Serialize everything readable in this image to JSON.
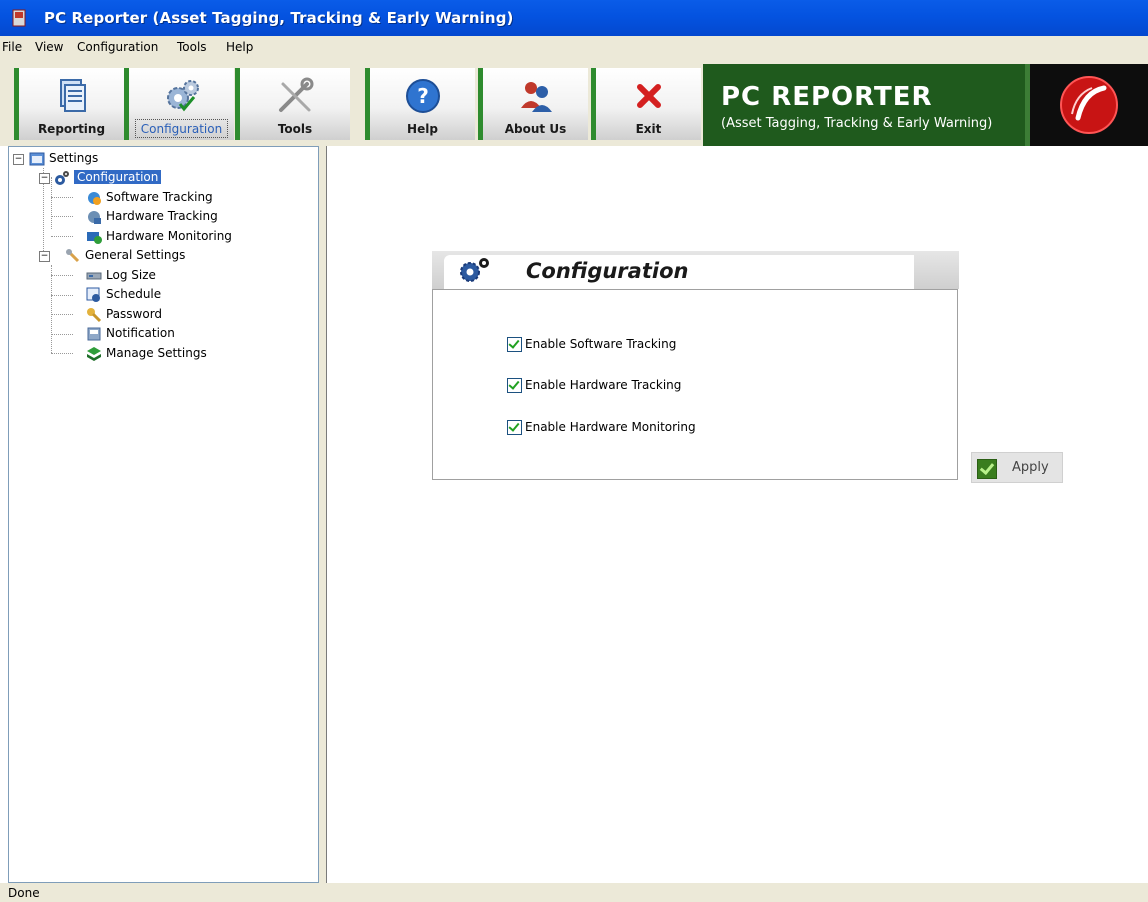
{
  "window": {
    "title": "PC Reporter (Asset Tagging, Tracking & Early Warning)"
  },
  "menu": [
    "File",
    "View",
    "Configuration",
    "Tools",
    "Help"
  ],
  "toolbar": {
    "buttons": [
      {
        "label": "Reporting",
        "icon": "reporting-icon"
      },
      {
        "label": "Configuration",
        "icon": "configuration-gears-icon",
        "active": true
      },
      {
        "label": "Tools",
        "icon": "tools-icon"
      },
      {
        "label": "Help",
        "icon": "help-icon"
      },
      {
        "label": "About Us",
        "icon": "about-us-icon"
      },
      {
        "label": "Exit",
        "icon": "exit-icon"
      }
    ],
    "banner_title": "PC REPORTER",
    "banner_subtitle": "(Asset Tagging, Tracking & Early Warning)"
  },
  "tree": {
    "root": "Settings",
    "configuration": "Configuration",
    "software_tracking": "Software Tracking",
    "hardware_tracking": "Hardware Tracking",
    "hardware_monitoring": "Hardware Monitoring",
    "general_settings": "General Settings",
    "log_size": "Log Size",
    "schedule": "Schedule",
    "password": "Password",
    "notification": "Notification",
    "manage_settings": "Manage Settings"
  },
  "panel": {
    "title": "Configuration",
    "options": [
      {
        "label": "Enable Software Tracking",
        "checked": true
      },
      {
        "label": "Enable Hardware Tracking",
        "checked": true
      },
      {
        "label": "Enable Hardware Monitoring",
        "checked": true
      }
    ],
    "apply_label": "Apply"
  },
  "status": {
    "text": "Done"
  },
  "colors": {
    "titlebar": "#0453e0",
    "accent_green": "#2e8b2e",
    "selection": "#316ac5",
    "banner": "#1f5a1d"
  }
}
